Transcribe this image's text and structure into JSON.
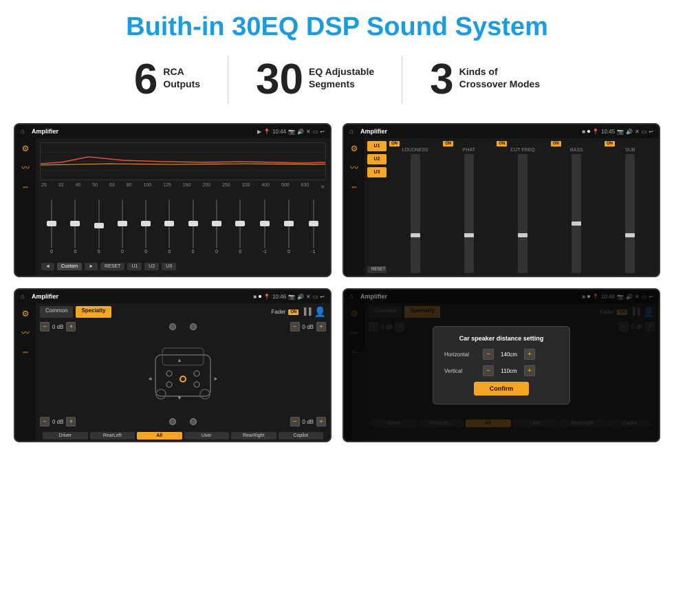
{
  "page": {
    "title": "Buith-in 30EQ DSP Sound System"
  },
  "stats": [
    {
      "number": "6",
      "text": "RCA\nOutputs"
    },
    {
      "number": "30",
      "text": "EQ Adjustable\nSegments"
    },
    {
      "number": "3",
      "text": "Kinds of\nCrossover Modes"
    }
  ],
  "screenshots": {
    "eq": {
      "app": "Amplifier",
      "time": "10:44",
      "freq_labels": [
        "25",
        "32",
        "40",
        "50",
        "63",
        "80",
        "100",
        "125",
        "160",
        "200",
        "250",
        "320",
        "400",
        "500",
        "630"
      ],
      "slider_values": [
        "0",
        "0",
        "0",
        "5",
        "0",
        "0",
        "0",
        "0",
        "0",
        "0",
        "-1",
        "0",
        "-1"
      ],
      "bottom_btns": [
        "◄",
        "Custom",
        "►",
        "RESET",
        "U1",
        "U2",
        "U3"
      ]
    },
    "crossover": {
      "app": "Amplifier",
      "time": "10:45",
      "presets": [
        "U1",
        "U2",
        "U3"
      ],
      "channels": [
        {
          "label": "LOUDNESS",
          "on": true
        },
        {
          "label": "PHAT",
          "on": true
        },
        {
          "label": "CUT FREQ",
          "on": true
        },
        {
          "label": "BASS",
          "on": true
        },
        {
          "label": "SUB",
          "on": true
        }
      ],
      "reset_btn": "RESET"
    },
    "fader": {
      "app": "Amplifier",
      "time": "10:46",
      "tabs": [
        "Common",
        "Specialty"
      ],
      "fader_label": "Fader",
      "on_label": "ON",
      "db_values": [
        "0 dB",
        "0 dB",
        "0 dB",
        "0 dB"
      ],
      "bottom_btns": [
        "Driver",
        "RearLeft",
        "All",
        "User",
        "RearRight",
        "Copilot"
      ]
    },
    "distance": {
      "app": "Amplifier",
      "time": "10:46",
      "tabs": [
        "Common",
        "Specialty"
      ],
      "dialog_title": "Car speaker distance setting",
      "horizontal_label": "Horizontal",
      "horizontal_value": "140cm",
      "vertical_label": "Vertical",
      "vertical_value": "110cm",
      "confirm_btn": "Confirm",
      "db_values": [
        "0 dB",
        "0 dB"
      ],
      "bottom_btns": [
        "Driver",
        "RearLeft",
        "All",
        "User",
        "RearRight",
        "Copilot"
      ]
    }
  }
}
